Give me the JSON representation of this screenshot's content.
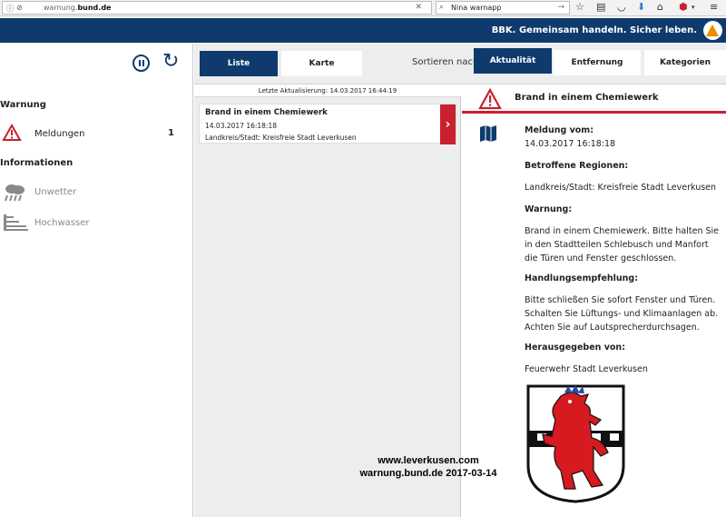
{
  "browser": {
    "url_prefix": "warnung.",
    "url_domain": "bund.de",
    "search_text": "Nina warnapp"
  },
  "header": {
    "slogan": "BBK. Gemeinsam handeln. Sicher leben."
  },
  "sidebar": {
    "warning_heading": "Warnung",
    "warning_items": [
      {
        "label": "Meldungen",
        "count": "1"
      }
    ],
    "info_heading": "Informationen",
    "info_items": [
      {
        "label": "Unwetter"
      },
      {
        "label": "Hochwasser"
      }
    ]
  },
  "controls": {
    "view_buttons": [
      "Liste",
      "Karte"
    ],
    "sort_label": "Sortieren nach:",
    "sort_buttons": [
      "Aktualität",
      "Entfernung",
      "Kategorien"
    ]
  },
  "list": {
    "last_update": "Letzte Aktualisierung: 14.03.2017 16:44:19",
    "items": [
      {
        "title": "Brand in einem Chemiewerk",
        "date": "14.03.2017 16:18:18",
        "region": "Landkreis/Stadt: Kreisfreie Stadt Leverkusen"
      }
    ]
  },
  "detail": {
    "title": "Brand in einem Chemiewerk",
    "sent_label": "Meldung vom:",
    "sent_value": "14.03.2017 16:18:18",
    "regions_label": "Betroffene Regionen:",
    "regions_value": "Landkreis/Stadt: Kreisfreie Stadt Leverkusen",
    "warning_label": "Warnung:",
    "warning_text": "Brand in einem Chemiewerk. Bitte halten Sie in den Stadtteilen Schlebusch und Manfort die Türen und Fenster geschlossen.",
    "advice_label": "Handlungsempfehlung:",
    "advice_text": "Bitte schließen Sie sofort Fenster und Türen. Schalten Sie Lüftungs- und Klimaanlagen ab. Achten Sie auf Lautsprecherdurchsagen.",
    "issuer_label": "Herausgegeben von:",
    "issuer_value": "Feuerwehr Stadt Leverkusen"
  },
  "watermark": {
    "line1": "www.leverkusen.com",
    "line2": "warnung.bund.de 2017-03-14"
  },
  "colors": {
    "brand_blue": "#0f3a6d",
    "alert_red": "#c8202e",
    "logo_orange": "#f08c00"
  }
}
